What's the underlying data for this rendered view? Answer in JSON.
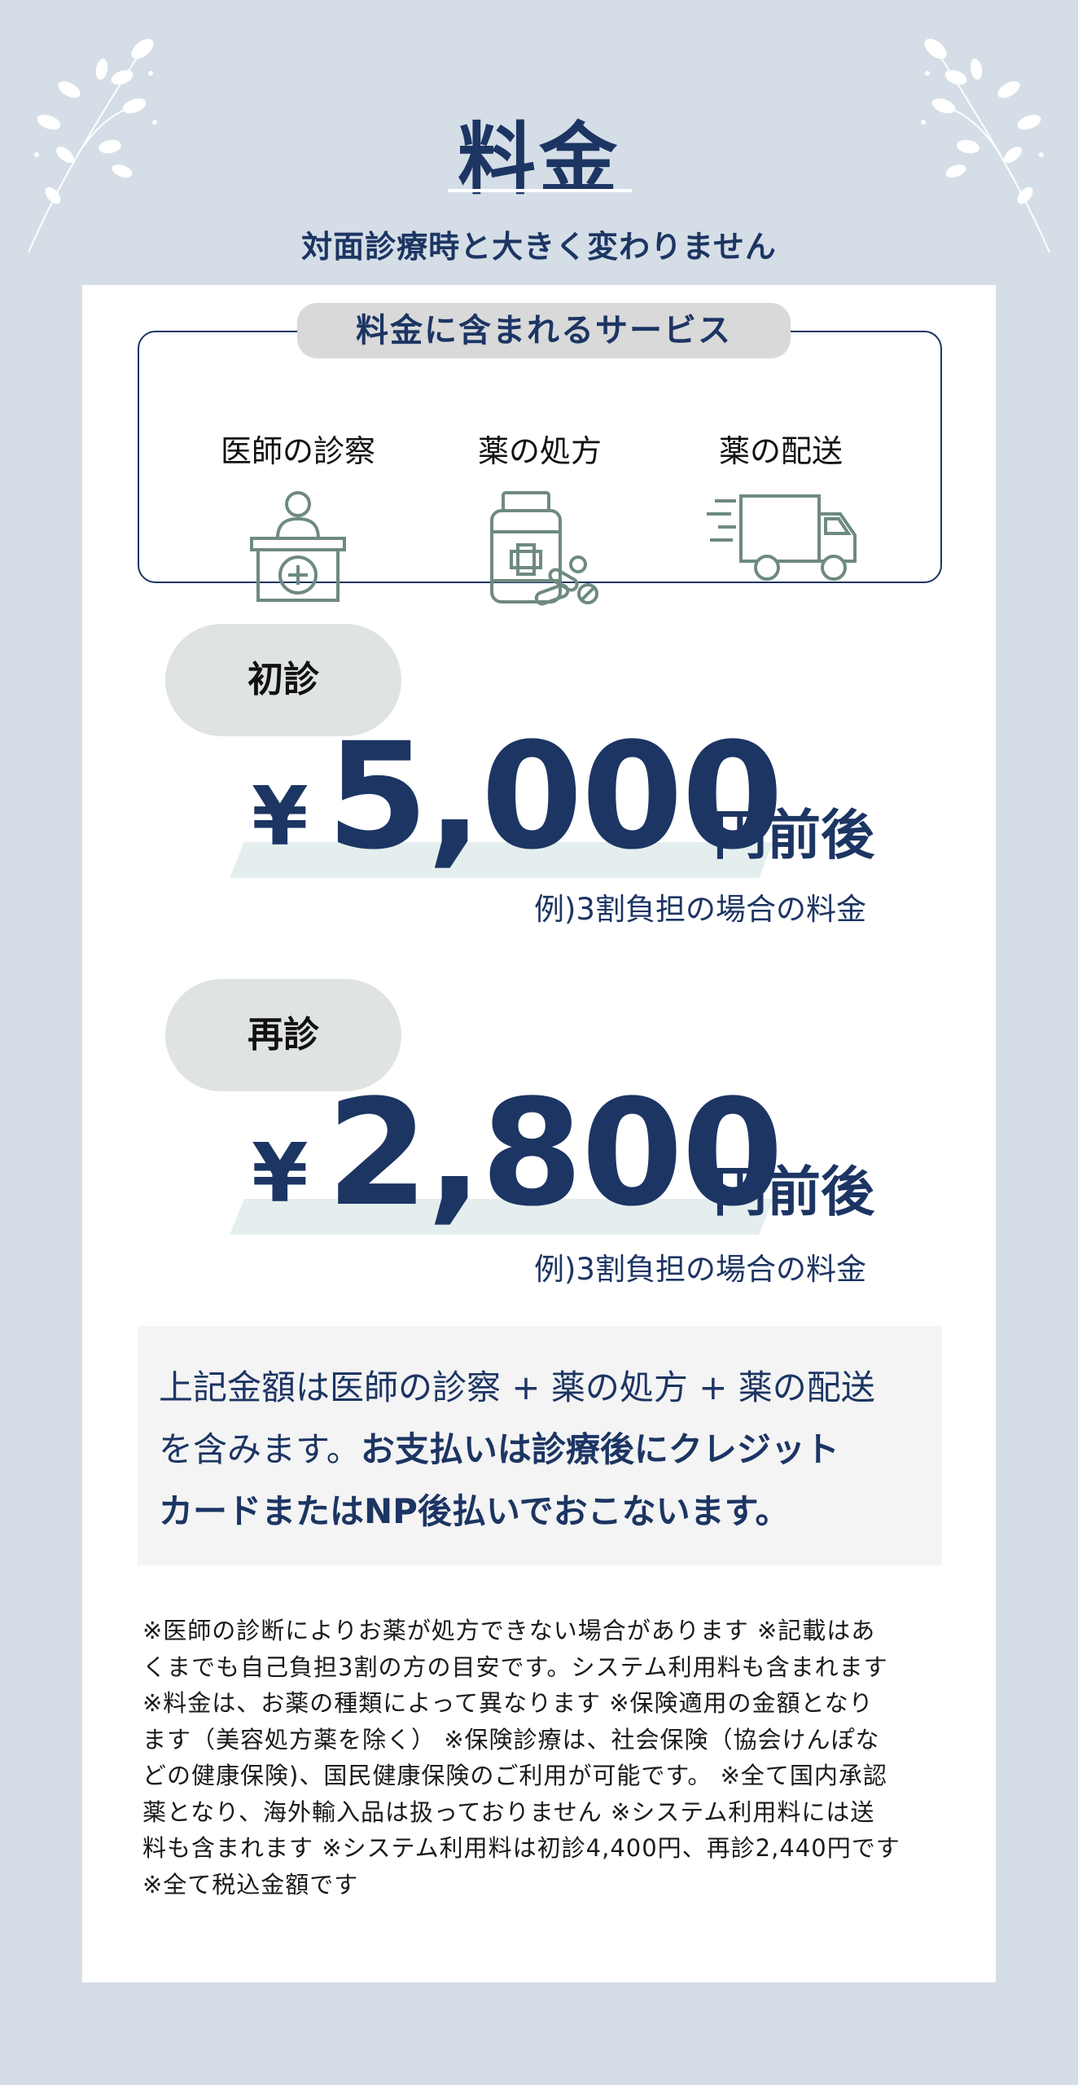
{
  "header": {
    "title": "料金",
    "subtitle": "対面診療時と大きく変わりません"
  },
  "services": {
    "heading": "料金に含まれるサービス",
    "items": [
      {
        "label": "医師の診察",
        "icon": "doctor-desk-icon"
      },
      {
        "label": "薬の処方",
        "icon": "medicine-bottle-icon"
      },
      {
        "label": "薬の配送",
        "icon": "delivery-truck-icon"
      }
    ]
  },
  "first_visit": {
    "tag": "初診",
    "yen": "¥",
    "amount": "5,000",
    "suffix": "円前後",
    "example": "例)3割負担の場合の料金"
  },
  "revisit": {
    "tag": "再診",
    "yen": "¥",
    "amount": "2,800",
    "suffix": "円前後",
    "example": "例)3割負担の場合の料金"
  },
  "summary": {
    "line1": "上記金額は医師の診察 + 薬の処方 + 薬の配送",
    "line2_normal": "を含みます。",
    "line2_bold": "お支払いは診療後にクレジット",
    "line3_bold": "カードまたはNP後払いでおこないます。"
  },
  "notes": {
    "lines": [
      "※医師の診断によりお薬が処方できない場合があります ※記載はあ",
      "くまでも自己負担3割の方の目安です。システム利用料も含まれます",
      "※料金は、お薬の種類によって異なります ※保険適用の金額となり",
      "ます（美容処方薬を除く） ※保険診療は、社会保険（協会けんぽな",
      "どの健康保険)、国民健康保険のご利用が可能です。 ※全て国内承認",
      "薬となり、海外輸入品は扱っておりません ※システム利用料には送",
      "料も含まれます ※システム利用料は初診4,400円、再診2,440円です",
      "※全て税込金額です"
    ]
  },
  "colors": {
    "background": "#d5dee6",
    "navy": "#1c3563",
    "icon_green": "#6f8a80",
    "pill_gray": "#d9d9d9",
    "tag_green": "#dfe4e1"
  }
}
